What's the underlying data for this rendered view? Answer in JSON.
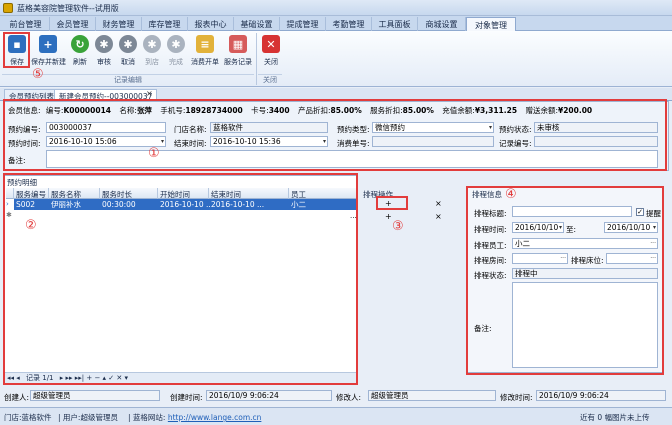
{
  "window": {
    "title": "蓝格美容院管理软件--试用版"
  },
  "menu_tabs": [
    "前台管理",
    "会员管理",
    "财务管理",
    "库存管理",
    "报表中心",
    "基础设置",
    "提成管理",
    "考勤管理",
    "工具面板",
    "商城设置",
    "对象管理"
  ],
  "ribbon": {
    "buttons": [
      "保存",
      "保存并新建",
      "刷新",
      "审核",
      "取消",
      "到店",
      "完成",
      "消费开单",
      "服务记录",
      "关闭"
    ],
    "group_record": "记录编辑",
    "group_close": "关闭"
  },
  "doc_tabs": [
    "会员预约列表",
    "新建会员预约--003000037"
  ],
  "annotations": [
    "⑤",
    "①",
    "②",
    "③",
    "④"
  ],
  "member_info": {
    "label": "会员信息:",
    "number_label": "编号:",
    "number": "K00000014",
    "name_label": "名称:",
    "name": "张萍",
    "phone_label": "手机号:",
    "phone": "18928734000",
    "card_label": "卡号:",
    "card": "3400",
    "product_discount_label": "产品折扣:",
    "product_discount": "85.00%",
    "service_discount_label": "服务折扣:",
    "service_discount": "85.00%",
    "balance_label": "充值余额:",
    "balance": "¥3,311.25",
    "gift_label": "赠送余额:",
    "gift": "¥200.00"
  },
  "form": {
    "appt_no_label": "预约编号:",
    "appt_no": "003000037",
    "store_label": "门店名称:",
    "store": "蓝格软件",
    "appt_type_label": "预约类型:",
    "appt_type": "微信预约",
    "appt_status_label": "预约状态:",
    "appt_status": "未审核",
    "appt_time_label": "预约时间:",
    "appt_time": "2016-10-10 15:06",
    "end_time_label": "结束时间:",
    "end_time": "2016-10-10 15:36",
    "consume_no_label": "消费单号:",
    "consume_no": "",
    "record_no_label": "记录编号:",
    "record_no": "",
    "remark_label": "备注:",
    "remark": ""
  },
  "detail": {
    "section_title": "预约明细",
    "columns": [
      "服务编号",
      "服务名称",
      "服务时长",
      "开始时间",
      "结束时间",
      "员工"
    ],
    "rows": [
      [
        "S002",
        "伊丽补水",
        "00:30:00",
        "2016-10-10 ...",
        "2016-10-10 ...",
        "小二"
      ]
    ],
    "nav": {
      "record": "记录 1/1"
    }
  },
  "schedule_op": {
    "title": "排程操作",
    "add": "+",
    "remove": "×",
    "more": "..."
  },
  "schedule_info": {
    "title": "排程信息",
    "subject_label": "排程标题:",
    "subject": "",
    "remind_label": "提醒",
    "remind": true,
    "time_label": "排程时间:",
    "time_start": "2016/10/10",
    "to_label": "至:",
    "time_end": "2016/10/10",
    "staff_label": "排程员工:",
    "staff": "小二",
    "room_label": "排程房间:",
    "room": "",
    "bed_label": "排程床位:",
    "bed": "",
    "state_label": "排程状态:",
    "state": "排程中",
    "note_label": "备注:",
    "note": ""
  },
  "audit": {
    "creator_label": "创建人:",
    "creator": "超级管理员",
    "create_time_label": "创建时间:",
    "create_time": "2016/10/9 9:06:24",
    "modifier_label": "修改人:",
    "modifier": "超级管理员",
    "modify_time_label": "修改时间:",
    "modify_time": "2016/10/9 9:06:24"
  },
  "status": {
    "store_label": "门店:",
    "store": "蓝格软件",
    "user_label": "用户:",
    "user": "超级管理员",
    "site_label": "蓝格网站:",
    "site": "http://www.lange.com.cn",
    "right": "近有 0 幅图片未上传"
  },
  "colors": {
    "accent": "#1f5fb8",
    "highlight": "#e23c3c"
  }
}
